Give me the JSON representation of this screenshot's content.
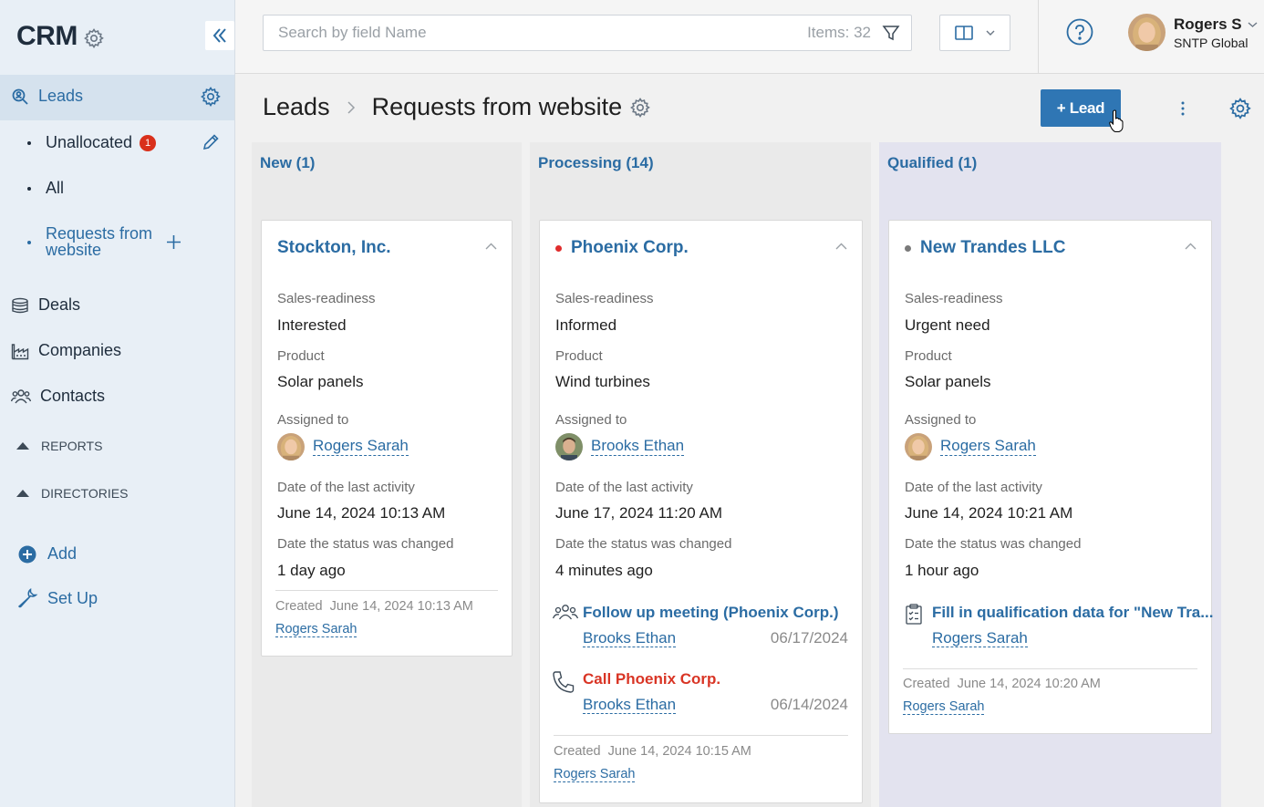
{
  "sidebar": {
    "title": "CRM",
    "leads": "Leads",
    "sub_items": [
      {
        "label": "Unallocated",
        "badge": "1"
      },
      {
        "label": "All"
      },
      {
        "label_line1": "Requests from",
        "label_line2": "website"
      }
    ],
    "deals": "Deals",
    "companies": "Companies",
    "contacts": "Contacts",
    "reports": "REPORTS",
    "directories": "DIRECTORIES",
    "add": "Add",
    "setup": "Set Up"
  },
  "topbar": {
    "search_placeholder": "Search by field Name",
    "items_count": "Items: 32",
    "user_name": "Rogers S",
    "user_org": "SNTP Global"
  },
  "header": {
    "breadcrumb_root": "Leads",
    "breadcrumb_current": "Requests from website",
    "add_button": "+ Lead"
  },
  "columns": [
    {
      "title": "New (1)"
    },
    {
      "title": "Processing (14)"
    },
    {
      "title": "Qualified (1)"
    }
  ],
  "labels": {
    "sales_readiness": "Sales-readiness",
    "product": "Product",
    "assigned_to": "Assigned to",
    "last_activity": "Date of the last activity",
    "status_changed": "Date the status was changed",
    "created": "Created"
  },
  "cards": [
    {
      "title": "Stockton, Inc.",
      "sales_readiness": "Interested",
      "product": "Solar panels",
      "assigned_to": "Rogers Sarah",
      "last_activity": "June 14, 2024 10:13 AM",
      "status_changed": "1 day ago",
      "created_date": "June 14, 2024 10:13 AM",
      "created_by": "Rogers Sarah"
    },
    {
      "title": "Phoenix Corp.",
      "status_color": "#e02d2d",
      "sales_readiness": "Informed",
      "product": "Wind turbines",
      "assigned_to": "Brooks Ethan",
      "last_activity": "June 17, 2024 11:20 AM",
      "status_changed": "4 minutes ago",
      "tasks": [
        {
          "title": "Follow up meeting (Phoenix Corp.)",
          "user": "Brooks Ethan",
          "date": "06/17/2024",
          "icon": "group-meeting-icon"
        },
        {
          "title": "Call Phoenix Corp.",
          "user": "Brooks Ethan",
          "date": "06/14/2024",
          "icon": "phone-icon",
          "overdue": true
        }
      ],
      "created_date": "June 14, 2024 10:15 AM",
      "created_by": "Rogers Sarah"
    },
    {
      "title": "New Trandes LLC",
      "status_color": "#7a7a7a",
      "sales_readiness": "Urgent need",
      "product": "Solar panels",
      "assigned_to": "Rogers Sarah",
      "last_activity": "June 14, 2024 10:21 AM",
      "status_changed": "1 hour ago",
      "tasks": [
        {
          "title": "Fill in qualification data for \"New Tra...",
          "user": "Rogers Sarah",
          "icon": "clipboard-icon"
        }
      ],
      "created_date": "June 14, 2024 10:20 AM",
      "created_by": "Rogers Sarah"
    }
  ],
  "colors": {
    "accent": "#2b6ca3",
    "button": "#2f76b4",
    "danger": "#d93525",
    "sidebar_bg": "#e8eff6"
  }
}
